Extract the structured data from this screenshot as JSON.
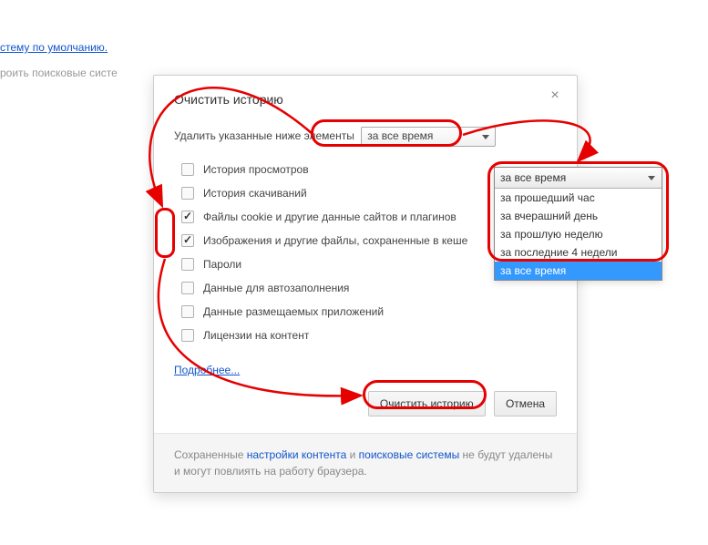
{
  "background": {
    "link_default": "стему по умолчанию.",
    "text_search": "роить поисковые систе"
  },
  "dialog": {
    "title": "Очистить историю",
    "prompt": "Удалить указанные ниже элементы",
    "select_value": "за все время",
    "items": [
      {
        "label": "История просмотров",
        "checked": false
      },
      {
        "label": "История скачиваний",
        "checked": false
      },
      {
        "label": "Файлы cookie и другие данные сайтов и плагинов",
        "checked": true
      },
      {
        "label": "Изображения и другие файлы, сохраненные в кеше",
        "checked": true
      },
      {
        "label": "Пароли",
        "checked": false
      },
      {
        "label": "Данные для автозаполнения",
        "checked": false
      },
      {
        "label": "Данные размещаемых приложений",
        "checked": false
      },
      {
        "label": "Лицензии на контент",
        "checked": false
      }
    ],
    "more": "Подробнее...",
    "btn_clear": "Очистить историю",
    "btn_cancel": "Отмена",
    "footer_t1": "Сохраненные ",
    "footer_l1": "настройки контента",
    "footer_t2": " и ",
    "footer_l2": "поисковые системы",
    "footer_t3": " не будут удалены и могут повлиять на работу браузера."
  },
  "dropdown": {
    "header": "за все время",
    "options": [
      {
        "label": "за прошедший час",
        "hl": false
      },
      {
        "label": "за вчерашний день",
        "hl": false
      },
      {
        "label": "за прошлую неделю",
        "hl": false
      },
      {
        "label": "за последние 4 недели",
        "hl": false
      },
      {
        "label": "за все время",
        "hl": true
      }
    ]
  }
}
